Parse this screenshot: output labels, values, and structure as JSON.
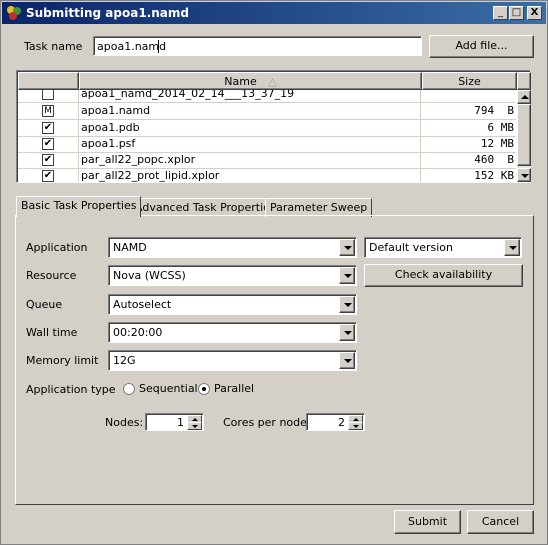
{
  "window": {
    "title": "Submitting apoa1.namd",
    "minimize": "_",
    "maximize": "□",
    "close": "X"
  },
  "task": {
    "name_label": "Task name",
    "name_value": "apoa1.namd",
    "add_file_label": "Add file..."
  },
  "files_table": {
    "col_name": "Name",
    "col_size": "Size",
    "rows": [
      {
        "check": "",
        "name": "apoa1_namd_2014_02_14___13_37_19",
        "size": ""
      },
      {
        "check": "M",
        "name": "apoa1.namd",
        "size": "794  B"
      },
      {
        "check": "✔",
        "name": "apoa1.pdb",
        "size": "6 MB"
      },
      {
        "check": "✔",
        "name": "apoa1.psf",
        "size": "12 MB"
      },
      {
        "check": "✔",
        "name": "par_all22_popc.xplor",
        "size": "460  B"
      },
      {
        "check": "✔",
        "name": "par_all22_prot_lipid.xplor",
        "size": "152 KB"
      }
    ]
  },
  "tabs": [
    "Basic Task Properties",
    "Advanced Task Properties",
    "Parameter Sweep"
  ],
  "form": {
    "application_label": "Application",
    "application_value": "NAMD",
    "version_value": "Default version",
    "resource_label": "Resource",
    "resource_value": "Nova (WCSS)",
    "check_availability_label": "Check availability",
    "queue_label": "Queue",
    "queue_value": "Autoselect",
    "walltime_label": "Wall time",
    "walltime_value": "00:20:00",
    "memory_label": "Memory limit",
    "memory_value": "12G",
    "apptype_label": "Application type",
    "sequential_label": "Sequential",
    "parallel_label": "Parallel",
    "nodes_label": "Nodes:",
    "nodes_value": "1",
    "cores_label": "Cores per node:",
    "cores_value": "2"
  },
  "footer": {
    "submit_label": "Submit",
    "cancel_label": "Cancel"
  }
}
